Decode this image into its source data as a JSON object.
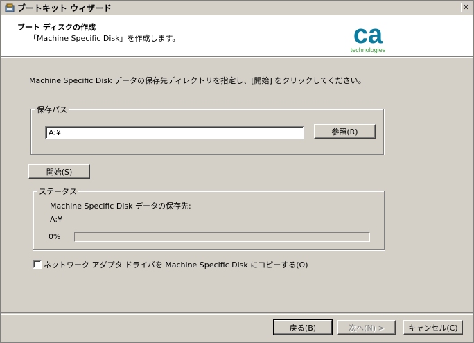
{
  "window": {
    "title": "ブートキット ウィザード",
    "close_glyph": "✕"
  },
  "header": {
    "title": "ブート ディスクの作成",
    "subtitle": "「Machine Specific Disk」を作成します。",
    "logo": {
      "mark": "ca",
      "text": "technologies",
      "color": "#0a7c9f",
      "text_color": "#3a9a3a"
    }
  },
  "instruction": "Machine Specific Disk データの保存先ディレクトリを指定し、[開始] をクリックしてください。",
  "save_path": {
    "group_label": "保存パス",
    "value": "A:¥",
    "browse_label": "参照(R)"
  },
  "start_label": "開始(S)",
  "status": {
    "group_label": "ステータス",
    "dest_label": "Machine Specific Disk データの保存先:",
    "dest_value": "A:¥",
    "progress_text": "0%",
    "progress": 0
  },
  "copy_driver": {
    "label": "ネットワーク アダプタ ドライバを Machine Specific Disk にコピーする(O)",
    "checked": false
  },
  "buttons": {
    "back": "戻る(B)",
    "next": "次へ(N) >",
    "cancel": "キャンセル(C)"
  }
}
